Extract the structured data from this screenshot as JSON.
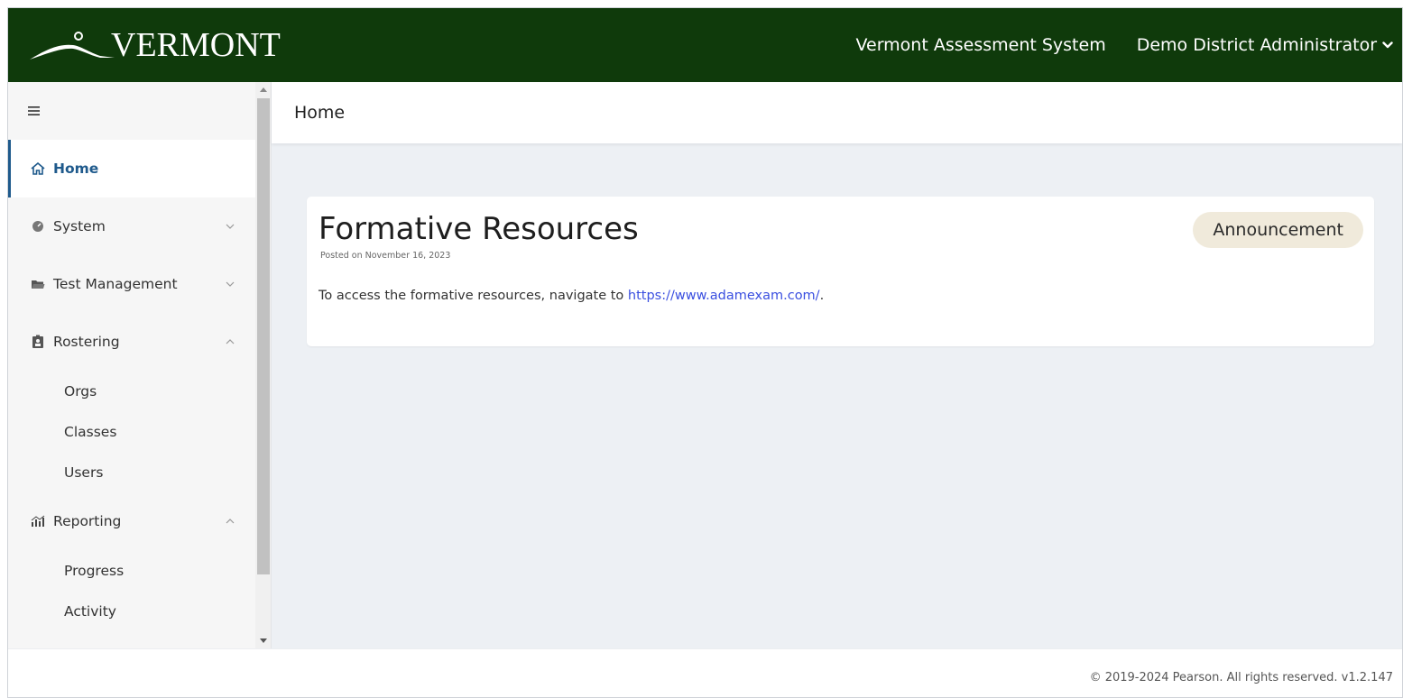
{
  "header": {
    "logo_text": "VERMONT",
    "app_name": "Vermont Assessment System",
    "user_menu_label": "Demo District Administrator"
  },
  "page": {
    "breadcrumb": "Home"
  },
  "sidebar": {
    "items": [
      {
        "label": "Home",
        "icon": "home-icon",
        "active": true
      },
      {
        "label": "System",
        "icon": "gauge-icon",
        "expandable": true,
        "expanded": false
      },
      {
        "label": "Test Management",
        "icon": "folder-icon",
        "expandable": true,
        "expanded": false
      },
      {
        "label": "Rostering",
        "icon": "badge-id-icon",
        "expandable": true,
        "expanded": true
      },
      {
        "label": "Reporting",
        "icon": "bar-chart-icon",
        "expandable": true,
        "expanded": true
      }
    ],
    "rostering_children": [
      "Orgs",
      "Classes",
      "Users"
    ],
    "reporting_children": [
      "Progress",
      "Activity"
    ]
  },
  "announcement": {
    "title": "Formative Resources",
    "posted": "Posted on November 16, 2023",
    "badge": "Announcement",
    "body_prefix": "To access the formative resources, navigate to ",
    "link_text": "https://www.adamexam.com/",
    "body_suffix": "."
  },
  "footer": {
    "text": "© 2019-2024 Pearson. All rights reserved. v1.2.147"
  },
  "colors": {
    "header_bg": "#0f3a0b",
    "active_nav": "#1f5a8c",
    "link": "#3a4fe0",
    "badge_bg": "#f0eadb",
    "main_bg": "#edf0f4"
  }
}
